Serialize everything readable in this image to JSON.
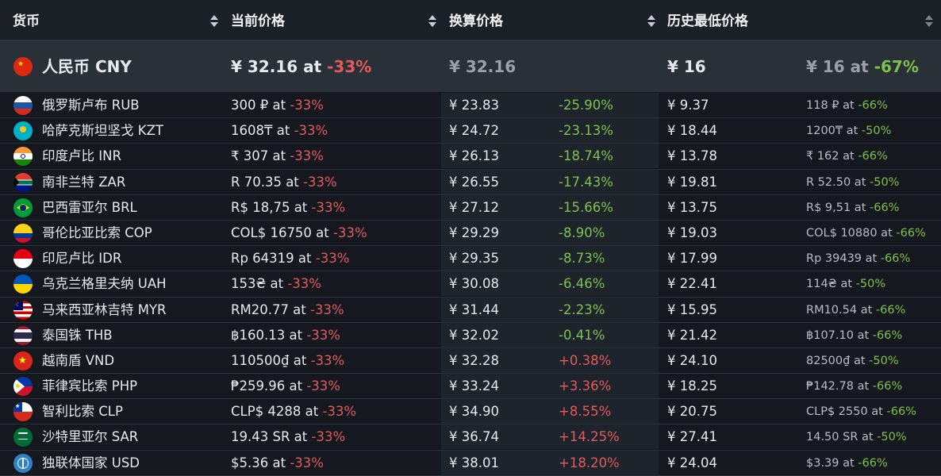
{
  "header": {
    "col_currency": "货币",
    "col_current": "当前价格",
    "col_converted": "换算价格",
    "col_lowest": "历史最低价格"
  },
  "base": {
    "flag": "cn",
    "name": "人民币 CNY",
    "price": "¥ 32.16 at ",
    "discount": "-33%",
    "converted": "¥ 32.16",
    "lowest": "¥ 16",
    "lowest_price": "¥ 16 at ",
    "lowest_discount": "-67%"
  },
  "rows": [
    {
      "flag": "ru",
      "name": "俄罗斯卢布 RUB",
      "price": "300 ₽ at ",
      "discount": "-33%",
      "converted": "¥ 23.83",
      "diff": "-25.90%",
      "diff_sign": "neg",
      "lowest": "¥ 9.37",
      "low_price": "118 ₽ at ",
      "low_discount": "-66%"
    },
    {
      "flag": "kz",
      "name": "哈萨克斯坦坚戈 KZT",
      "price": "1608₸ at ",
      "discount": "-33%",
      "converted": "¥ 24.72",
      "diff": "-23.13%",
      "diff_sign": "neg",
      "lowest": "¥ 18.44",
      "low_price": "1200₸ at ",
      "low_discount": "-50%"
    },
    {
      "flag": "in",
      "name": "印度卢比 INR",
      "price": "₹ 307 at ",
      "discount": "-33%",
      "converted": "¥ 26.13",
      "diff": "-18.74%",
      "diff_sign": "neg",
      "lowest": "¥ 13.78",
      "low_price": "₹ 162 at ",
      "low_discount": "-66%"
    },
    {
      "flag": "za",
      "name": "南非兰特 ZAR",
      "price": "R 70.35 at ",
      "discount": "-33%",
      "converted": "¥ 26.55",
      "diff": "-17.43%",
      "diff_sign": "neg",
      "lowest": "¥ 19.81",
      "low_price": "R 52.50 at ",
      "low_discount": "-50%"
    },
    {
      "flag": "br",
      "name": "巴西雷亚尔 BRL",
      "price": "R$ 18,75 at ",
      "discount": "-33%",
      "converted": "¥ 27.12",
      "diff": "-15.66%",
      "diff_sign": "neg",
      "lowest": "¥ 13.75",
      "low_price": "R$ 9,51 at ",
      "low_discount": "-66%"
    },
    {
      "flag": "co",
      "name": "哥伦比亚比索 COP",
      "price": "COL$ 16750 at ",
      "discount": "-33%",
      "converted": "¥ 29.29",
      "diff": "-8.90%",
      "diff_sign": "neg",
      "lowest": "¥ 19.03",
      "low_price": "COL$ 10880 at ",
      "low_discount": "-66%"
    },
    {
      "flag": "id",
      "name": "印尼卢比 IDR",
      "price": "Rp 64319 at ",
      "discount": "-33%",
      "converted": "¥ 29.35",
      "diff": "-8.73%",
      "diff_sign": "neg",
      "lowest": "¥ 17.99",
      "low_price": "Rp 39439 at ",
      "low_discount": "-66%"
    },
    {
      "flag": "ua",
      "name": "乌克兰格里夫纳 UAH",
      "price": "153₴ at ",
      "discount": "-33%",
      "converted": "¥ 30.08",
      "diff": "-6.46%",
      "diff_sign": "neg",
      "lowest": "¥ 22.41",
      "low_price": "114₴ at ",
      "low_discount": "-50%"
    },
    {
      "flag": "my",
      "name": "马来西亚林吉特 MYR",
      "price": "RM20.77 at ",
      "discount": "-33%",
      "converted": "¥ 31.44",
      "diff": "-2.23%",
      "diff_sign": "neg",
      "lowest": "¥ 15.95",
      "low_price": "RM10.54 at ",
      "low_discount": "-66%"
    },
    {
      "flag": "th",
      "name": "泰国铢 THB",
      "price": "฿160.13 at ",
      "discount": "-33%",
      "converted": "¥ 32.02",
      "diff": "-0.41%",
      "diff_sign": "neg",
      "lowest": "¥ 21.42",
      "low_price": "฿107.10 at ",
      "low_discount": "-66%"
    },
    {
      "flag": "vn",
      "name": "越南盾 VND",
      "price": "110500₫ at ",
      "discount": "-33%",
      "converted": "¥ 32.28",
      "diff": "+0.38%",
      "diff_sign": "pos",
      "lowest": "¥ 24.10",
      "low_price": "82500₫ at ",
      "low_discount": "-50%"
    },
    {
      "flag": "ph",
      "name": "菲律宾比索 PHP",
      "price": "₱259.96 at ",
      "discount": "-33%",
      "converted": "¥ 33.24",
      "diff": "+3.36%",
      "diff_sign": "pos",
      "lowest": "¥ 18.25",
      "low_price": "₱142.78 at ",
      "low_discount": "-66%"
    },
    {
      "flag": "cl",
      "name": "智利比索 CLP",
      "price": "CLP$ 4288 at ",
      "discount": "-33%",
      "converted": "¥ 34.90",
      "diff": "+8.55%",
      "diff_sign": "pos",
      "lowest": "¥ 20.75",
      "low_price": "CLP$ 2550 at ",
      "low_discount": "-66%"
    },
    {
      "flag": "sa",
      "name": "沙特里亚尔 SAR",
      "price": "19.43 SR at ",
      "discount": "-33%",
      "converted": "¥ 36.74",
      "diff": "+14.25%",
      "diff_sign": "pos",
      "lowest": "¥ 27.41",
      "low_price": "14.50 SR at ",
      "low_discount": "-50%"
    },
    {
      "flag": "un",
      "name": "独联体国家 USD",
      "price": "$5.36 at ",
      "discount": "-33%",
      "converted": "¥ 38.01",
      "diff": "+18.20%",
      "diff_sign": "pos",
      "lowest": "¥ 24.04",
      "low_price": "$3.39 at ",
      "low_discount": "-66%"
    }
  ],
  "colors": {
    "negative": "#e35a5a",
    "positive": "#7dc24a",
    "background": "#15191f",
    "header": "#1b1f26"
  }
}
